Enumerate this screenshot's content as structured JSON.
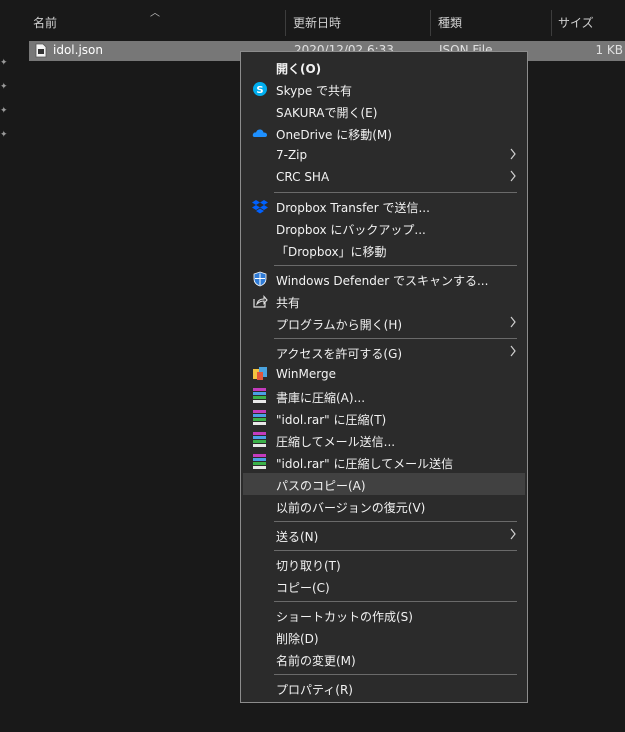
{
  "columns": {
    "name": "名前",
    "modified": "更新日時",
    "type": "種類",
    "size": "サイズ"
  },
  "file": {
    "name": "idol.json",
    "modified": "2020/12/02 6:33",
    "type": "JSON File",
    "size": "1 KB"
  },
  "menu": {
    "open": "開く(O)",
    "skype_share": "Skype で共有",
    "sakura_open": "SAKURAで開く(E)",
    "onedrive_move": "OneDrive に移動(M)",
    "zip7": "7-Zip",
    "crc_sha": "CRC SHA",
    "dropbox_transfer": "Dropbox Transfer で送信...",
    "dropbox_backup": "Dropbox にバックアップ...",
    "dropbox_move": "「Dropbox」に移動",
    "defender_scan": "Windows Defender でスキャンする...",
    "share": "共有",
    "open_with": "プログラムから開く(H)",
    "give_access": "アクセスを許可する(G)",
    "winmerge": "WinMerge",
    "add_archive": "書庫に圧縮(A)...",
    "compress_rar": "\"idol.rar\" に圧縮(T)",
    "compress_email": "圧縮してメール送信...",
    "compress_rar_email": "\"idol.rar\" に圧縮してメール送信",
    "copy_path": "パスのコピー(A)",
    "restore_previous": "以前のバージョンの復元(V)",
    "send_to": "送る(N)",
    "cut": "切り取り(T)",
    "copy": "コピー(C)",
    "create_shortcut": "ショートカットの作成(S)",
    "delete": "削除(D)",
    "rename": "名前の変更(M)",
    "properties": "プロパティ(R)"
  },
  "colors": {
    "menu_bg": "#2b2b2b",
    "highlight": "#414141",
    "accent_blue": "#1e90ff",
    "dropbox_blue": "#0061fe"
  }
}
